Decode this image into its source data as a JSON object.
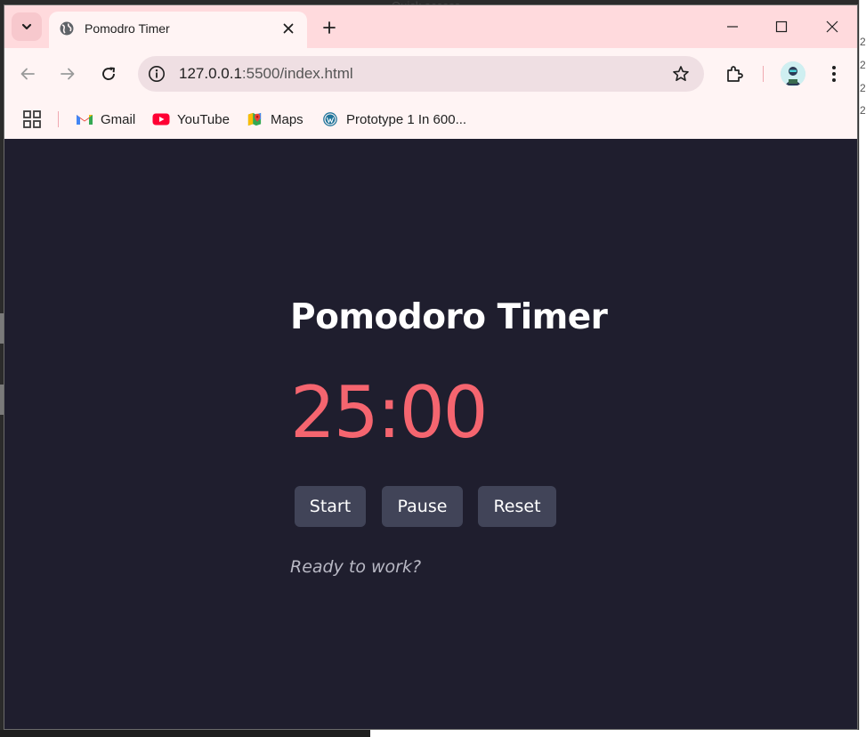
{
  "browser": {
    "tab": {
      "title": "Pomodro Timer"
    },
    "address_bar": {
      "host": "127.0.0.1",
      "path": ":5500/index.html"
    },
    "bookmarks": [
      {
        "label": "Gmail",
        "icon": "gmail-icon"
      },
      {
        "label": "YouTube",
        "icon": "youtube-icon"
      },
      {
        "label": "Maps",
        "icon": "maps-icon"
      },
      {
        "label": "Prototype 1 In 600...",
        "icon": "wordpress-icon"
      }
    ]
  },
  "app": {
    "title": "Pomodoro Timer",
    "time": "25:00",
    "buttons": {
      "start": "Start",
      "pause": "Pause",
      "reset": "Reset"
    },
    "status": "Ready to work?"
  },
  "background": {
    "explorer_peek": "Quick access",
    "side_numbers": [
      "2",
      "2",
      "2",
      "2"
    ]
  },
  "colors": {
    "page_background": "#1f1e2e",
    "timer_text": "#f5656f",
    "button_background": "#414458",
    "tabstrip": "#ffdadd",
    "toolbar": "#fff4f4"
  }
}
